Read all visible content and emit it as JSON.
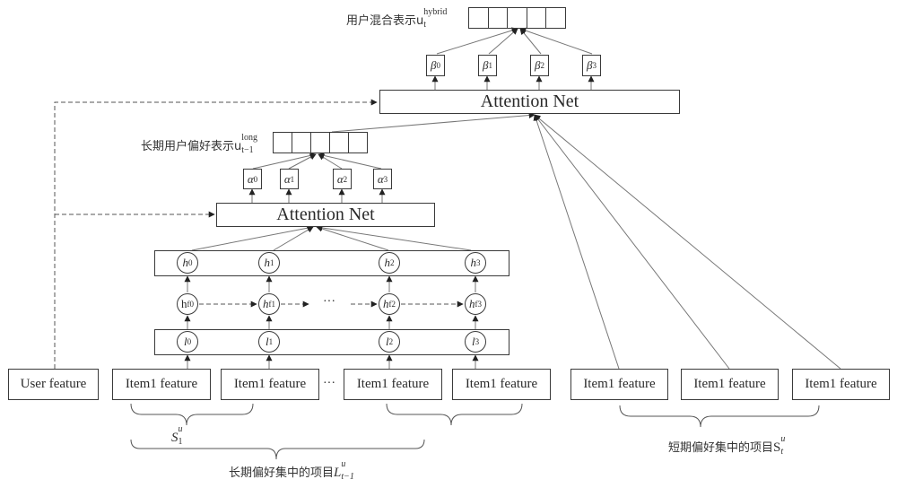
{
  "diagram": {
    "hybrid_label": {
      "text": "用户混合表示u",
      "sup": "hybrid",
      "sub": "t"
    },
    "long_label": {
      "text": "长期用户偏好表示u",
      "sup": "long",
      "sub": "t−1"
    },
    "top_attention": "Attention Net",
    "mid_attention": "Attention Net",
    "beta_weights": [
      {
        "sym": "β",
        "idx": "0"
      },
      {
        "sym": "β",
        "idx": "1"
      },
      {
        "sym": "β",
        "idx": "2"
      },
      {
        "sym": "β",
        "idx": "3"
      }
    ],
    "alpha_weights": [
      {
        "sym": "α",
        "idx": "0"
      },
      {
        "sym": "α",
        "idx": "1"
      },
      {
        "sym": "α",
        "idx": "2"
      },
      {
        "sym": "α",
        "idx": "3"
      }
    ],
    "h_nodes": [
      {
        "sym": "h",
        "idx": "0"
      },
      {
        "sym": "h",
        "idx": "1"
      },
      {
        "sym": "h",
        "idx": "2"
      },
      {
        "sym": "h",
        "idx": "3"
      }
    ],
    "hf_nodes": [
      {
        "sym": "h",
        "idx": "f0"
      },
      {
        "sym": "h",
        "idx": "f1"
      },
      {
        "sym": "h",
        "idx": "f2"
      },
      {
        "sym": "h",
        "idx": "f3"
      }
    ],
    "l_nodes": [
      {
        "sym": "l",
        "idx": "0"
      },
      {
        "sym": "l",
        "idx": "1"
      },
      {
        "sym": "l",
        "idx": "2"
      },
      {
        "sym": "l",
        "idx": "3"
      }
    ],
    "ellipsis": "···",
    "user_feature": "User feature",
    "long_items": [
      "Item1 feature",
      "Item1 feature",
      "Item1 feature",
      "Item1 feature"
    ],
    "short_items": [
      "Item1 feature",
      "Item1 feature",
      "Item1 feature"
    ],
    "s1_label": {
      "text": "S",
      "sup": "u",
      "sub": "1"
    },
    "long_set_label": {
      "text": "长期偏好集中的项目",
      "math": "L",
      "sup": "u",
      "sub": "t−1"
    },
    "short_set_label": {
      "text": "短期偏好集中的项目",
      "math": "S",
      "sup": "u",
      "sub": "t"
    }
  }
}
